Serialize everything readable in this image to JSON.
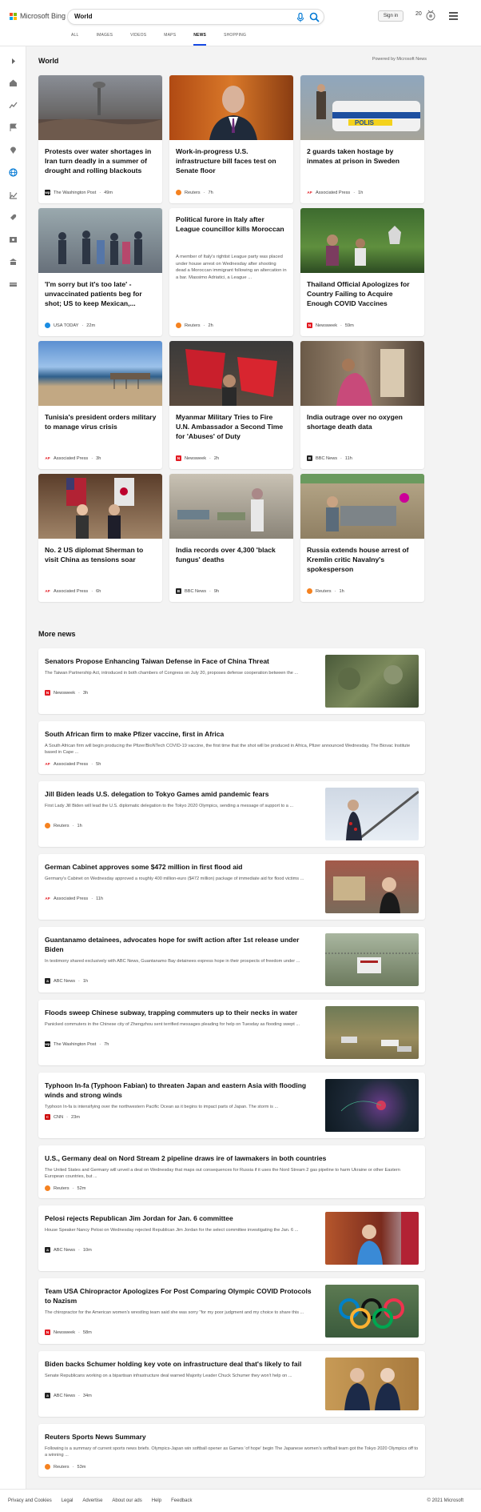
{
  "header": {
    "brand": "Microsoft Bing",
    "search_value": "World",
    "sign_in": "Sign in",
    "rewards_count": "20"
  },
  "tabs": [
    "ALL",
    "IMAGES",
    "VIDEOS",
    "MAPS",
    "NEWS",
    "SHOPPING"
  ],
  "active_tab": "NEWS",
  "world": {
    "heading": "World",
    "powered_by": "Powered by Microsoft News",
    "cards": [
      {
        "title": "Protests over water shortages in Iran turn deadly in a summer of drought and rolling blackouts",
        "source": "The Washington Post",
        "age": "49m",
        "icon": "wapo-icon"
      },
      {
        "title": "Work-in-progress U.S. infrastructure bill faces test on Senate floor",
        "source": "Reuters",
        "age": "7h",
        "icon": "reuters-icon"
      },
      {
        "title": "2 guards taken hostage by inmates at prison in Sweden",
        "source": "Associated Press",
        "age": "1h",
        "icon": "ap-icon"
      },
      {
        "title": "'I'm sorry but it's too late' - unvaccinated patients beg for shot; US to keep Mexican,...",
        "source": "USA TODAY",
        "age": "22m",
        "icon": "usatoday-icon"
      },
      {
        "title": "Political furore in Italy after League councillor kills Moroccan",
        "snippet": "A member of Italy's rightist League party was placed under house arrest on Wednesday after shooting dead a Moroccan immigrant following an altercation in a bar. Massimo Adriatici, a League ...",
        "source": "Reuters",
        "age": "2h",
        "icon": "reuters-icon"
      },
      {
        "title": "Thailand Official Apologizes for Country Failing to Acquire Enough COVID Vaccines",
        "source": "Newsweek",
        "age": "59m",
        "icon": "newsweek-icon"
      },
      {
        "title": "Tunisia's president orders military to manage virus crisis",
        "source": "Associated Press",
        "age": "3h",
        "icon": "ap-icon"
      },
      {
        "title": "Myanmar Military Tries to Fire U.N. Ambassador a Second Time for 'Abuses' of Duty",
        "source": "Newsweek",
        "age": "2h",
        "icon": "newsweek-icon"
      },
      {
        "title": "India outrage over no oxygen shortage death data",
        "source": "BBC News",
        "age": "11h",
        "icon": "bbc-icon"
      },
      {
        "title": "No. 2 US diplomat Sherman to visit China as tensions soar",
        "source": "Associated Press",
        "age": "6h",
        "icon": "ap-icon"
      },
      {
        "title": "India records over 4,300 'black fungus' deaths",
        "source": "BBC News",
        "age": "9h",
        "icon": "bbc-icon"
      },
      {
        "title": "Russia extends house arrest of Kremlin critic Navalny's spokesperson",
        "source": "Reuters",
        "age": "1h",
        "icon": "reuters-icon"
      }
    ]
  },
  "more_news": {
    "heading": "More news",
    "items": [
      {
        "title": "Senators Propose Enhancing Taiwan Defense in Face of China Threat",
        "snippet": "The Taiwan Partnership Act, introduced in both chambers of Congress on July 20, proposes defense cooperation between the ...",
        "source": "Newsweek",
        "age": "3h",
        "icon": "newsweek-icon"
      },
      {
        "title": "South African firm to make Pfizer vaccine, first in Africa",
        "snippet": "A South African firm will begin producing the Pfizer/BioNTech COVID-19 vaccine, the first time that the shot will be produced in Africa, Pfizer announced Wednesday. The Biovac Institute based in Cape ...",
        "source": "Associated Press",
        "age": "5h",
        "icon": "ap-icon"
      },
      {
        "title": "Jill Biden leads U.S. delegation to Tokyo Games amid pandemic fears",
        "snippet": "First Lady Jill Biden will lead the U.S. diplomatic delegation to the Tokyo 2020 Olympics, sending a message of support to a ...",
        "source": "Reuters",
        "age": "1h",
        "icon": "reuters-icon"
      },
      {
        "title": "German Cabinet approves some $472 million in first flood aid",
        "snippet": "Germany's Cabinet on Wednesday approved a roughly 400 million-euro ($472 million) package of immediate aid for flood victims ...",
        "source": "Associated Press",
        "age": "11h",
        "icon": "ap-icon"
      },
      {
        "title": "Guantanamo detainees, advocates hope for swift action after 1st release under Biden",
        "snippet": "In testimony shared exclusively with ABC News, Guantanamo Bay detainees express hope in their prospects of freedom under ...",
        "source": "ABC News",
        "age": "1h",
        "icon": "abc-icon"
      },
      {
        "title": "Floods sweep Chinese subway, trapping commuters up to their necks in water",
        "snippet": "Panicked commuters in the Chinese city of Zhengzhou sent terrified messages pleading for help on Tuesday as flooding swept ...",
        "source": "The Washington Post",
        "age": "7h",
        "icon": "wapo-icon"
      },
      {
        "title": "Typhoon In-fa (Typhoon Fabian) to threaten Japan and eastern Asia with flooding winds and strong winds",
        "snippet": "Typhoon In-fa is intensifying over the northwestern Pacific Ocean as it begins to impact parts of Japan. The storm is ...",
        "source": "CNN",
        "age": "23m",
        "icon": "cnn-icon"
      },
      {
        "title": "U.S., Germany deal on Nord Stream 2 pipeline draws ire of lawmakers in both countries",
        "snippet": "The United States and Germany will unveil a deal on Wednesday that maps out consequences for Russia if it uses the Nord Stream 2 gas pipeline to harm Ukraine or other Eastern European countries, but ...",
        "source": "Reuters",
        "age": "52m",
        "icon": "reuters-icon"
      },
      {
        "title": "Pelosi rejects Republican Jim Jordan for Jan. 6 committee",
        "snippet": "House Speaker Nancy Pelosi on Wednesday rejected Republican Jim Jordan for the select committee investigating the Jan. 6 ...",
        "source": "ABC News",
        "age": "10m",
        "icon": "abc-icon"
      },
      {
        "title": "Team USA Chiropractor Apologizes For Post Comparing Olympic COVID Protocols to Nazism",
        "snippet": "The chiropractor for the American women's wrestling team said she was sorry \"for my poor judgment and my choice to share this ...",
        "source": "Newsweek",
        "age": "58m",
        "icon": "newsweek-icon"
      },
      {
        "title": "Biden backs Schumer holding key vote on infrastructure deal that's likely to fail",
        "snippet": "Senate Republicans working on a bipartisan infrastructure deal warned Majority Leader Chuck Schumer they won't help on ...",
        "source": "ABC News",
        "age": "34m",
        "icon": "abc-icon"
      },
      {
        "title": "Reuters Sports News Summary",
        "snippet": "Following is a summary of current sports news briefs. Olympics-Japan win softball opener as Games 'of hope' begin The Japanese women's softball team got the Tokyo 2020 Olympics off to a winning ...",
        "source": "Reuters",
        "age": "53m",
        "icon": "reuters-icon"
      }
    ]
  },
  "footer": {
    "links": [
      "Privacy and Cookies",
      "Legal",
      "Advertise",
      "About our ads",
      "Help",
      "Feedback"
    ],
    "copyright": "© 2021 Microsoft"
  },
  "colors": {
    "accent": "#174ae4",
    "bing_blue": "#0078d4",
    "background": "#f3f3f3"
  }
}
